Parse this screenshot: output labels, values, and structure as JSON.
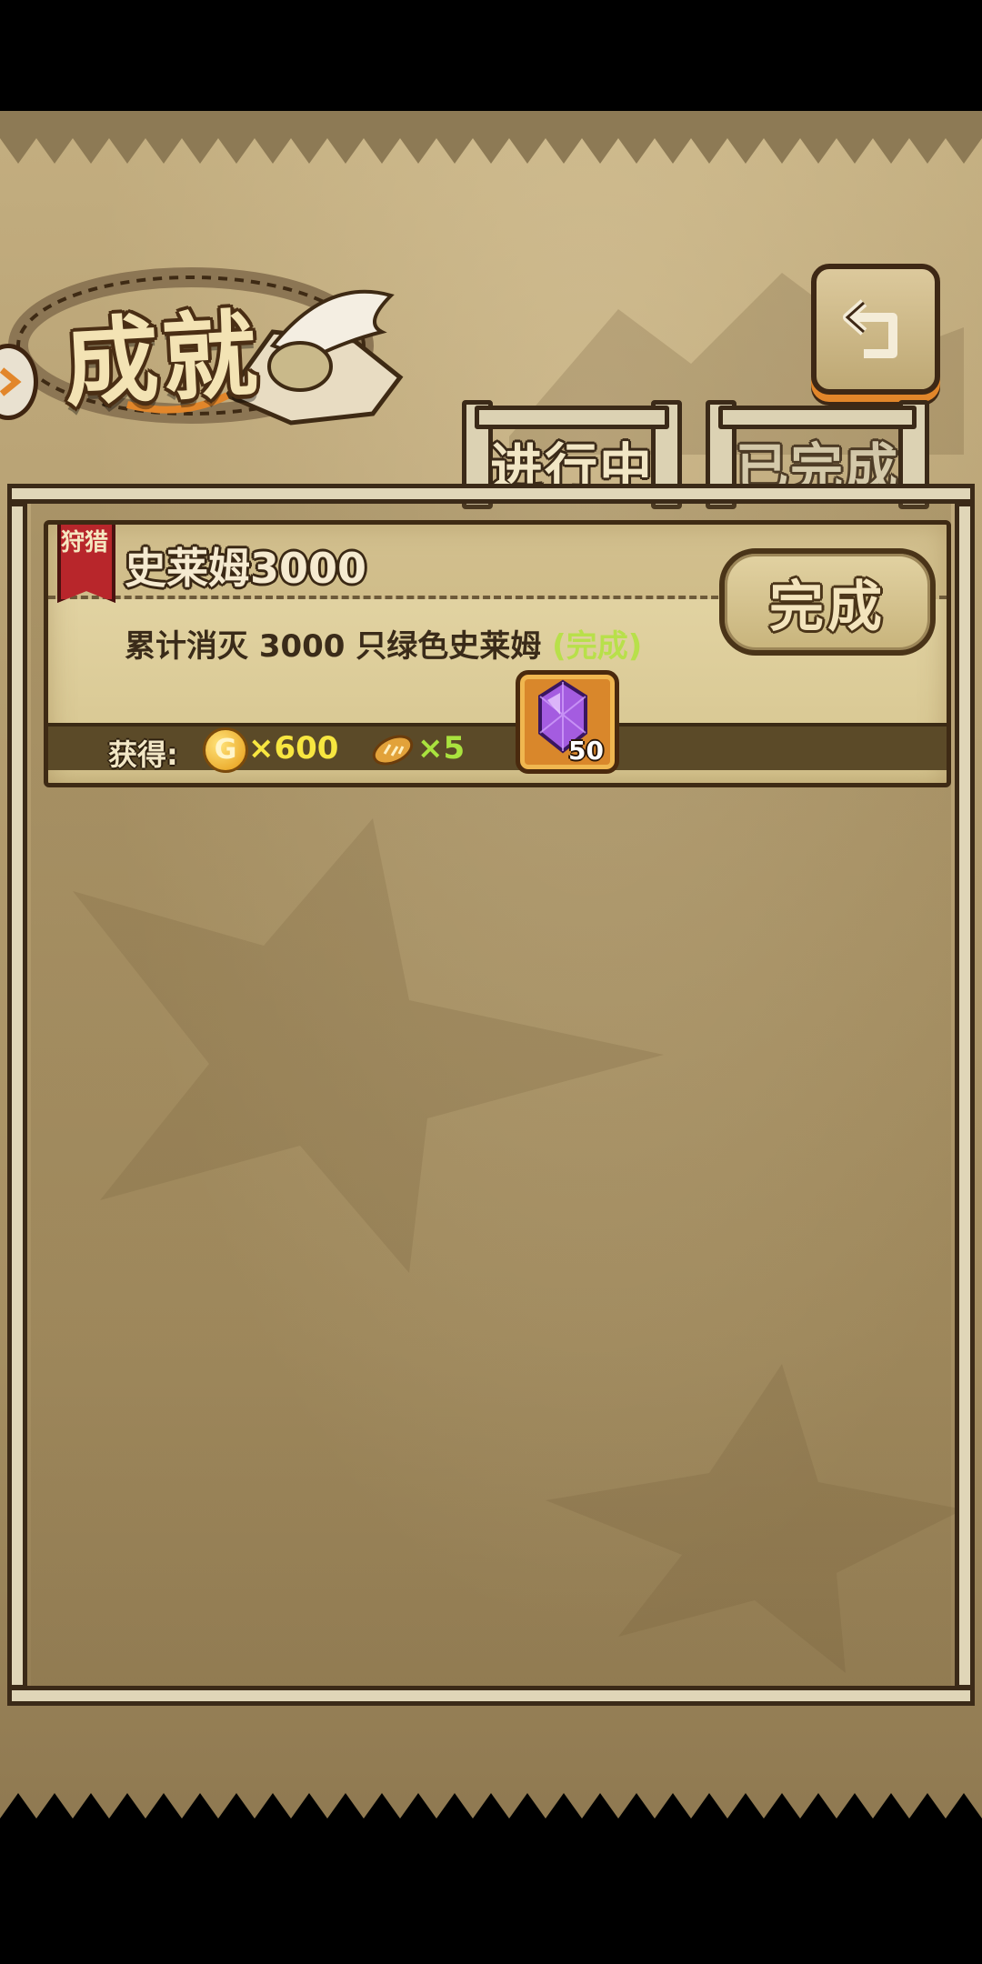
{
  "header": {
    "title": "成就",
    "back_icon": "return-arrow-icon"
  },
  "tabs": [
    {
      "label": "进行中",
      "active": true
    },
    {
      "label": "已完成",
      "active": false
    }
  ],
  "achievement": {
    "category": "狩猎",
    "title": "史莱姆3000",
    "description": "累计消灭 3000 只绿色史莱姆",
    "status": "(完成)",
    "complete_button": "完成",
    "reward_label": "获得:",
    "rewards": [
      {
        "icon": "gold-coin-icon",
        "symbol": "G",
        "amount": "×600",
        "color": "#f7e640"
      },
      {
        "icon": "bread-icon",
        "amount": "×5",
        "color": "#a9e23e"
      },
      {
        "icon": "purple-gem-icon",
        "amount": "50"
      }
    ]
  },
  "colors": {
    "parchment": "#b49d6f",
    "border_dark": "#3b2a18",
    "accent_orange": "#e2862a",
    "status_green": "#b8e04a"
  }
}
